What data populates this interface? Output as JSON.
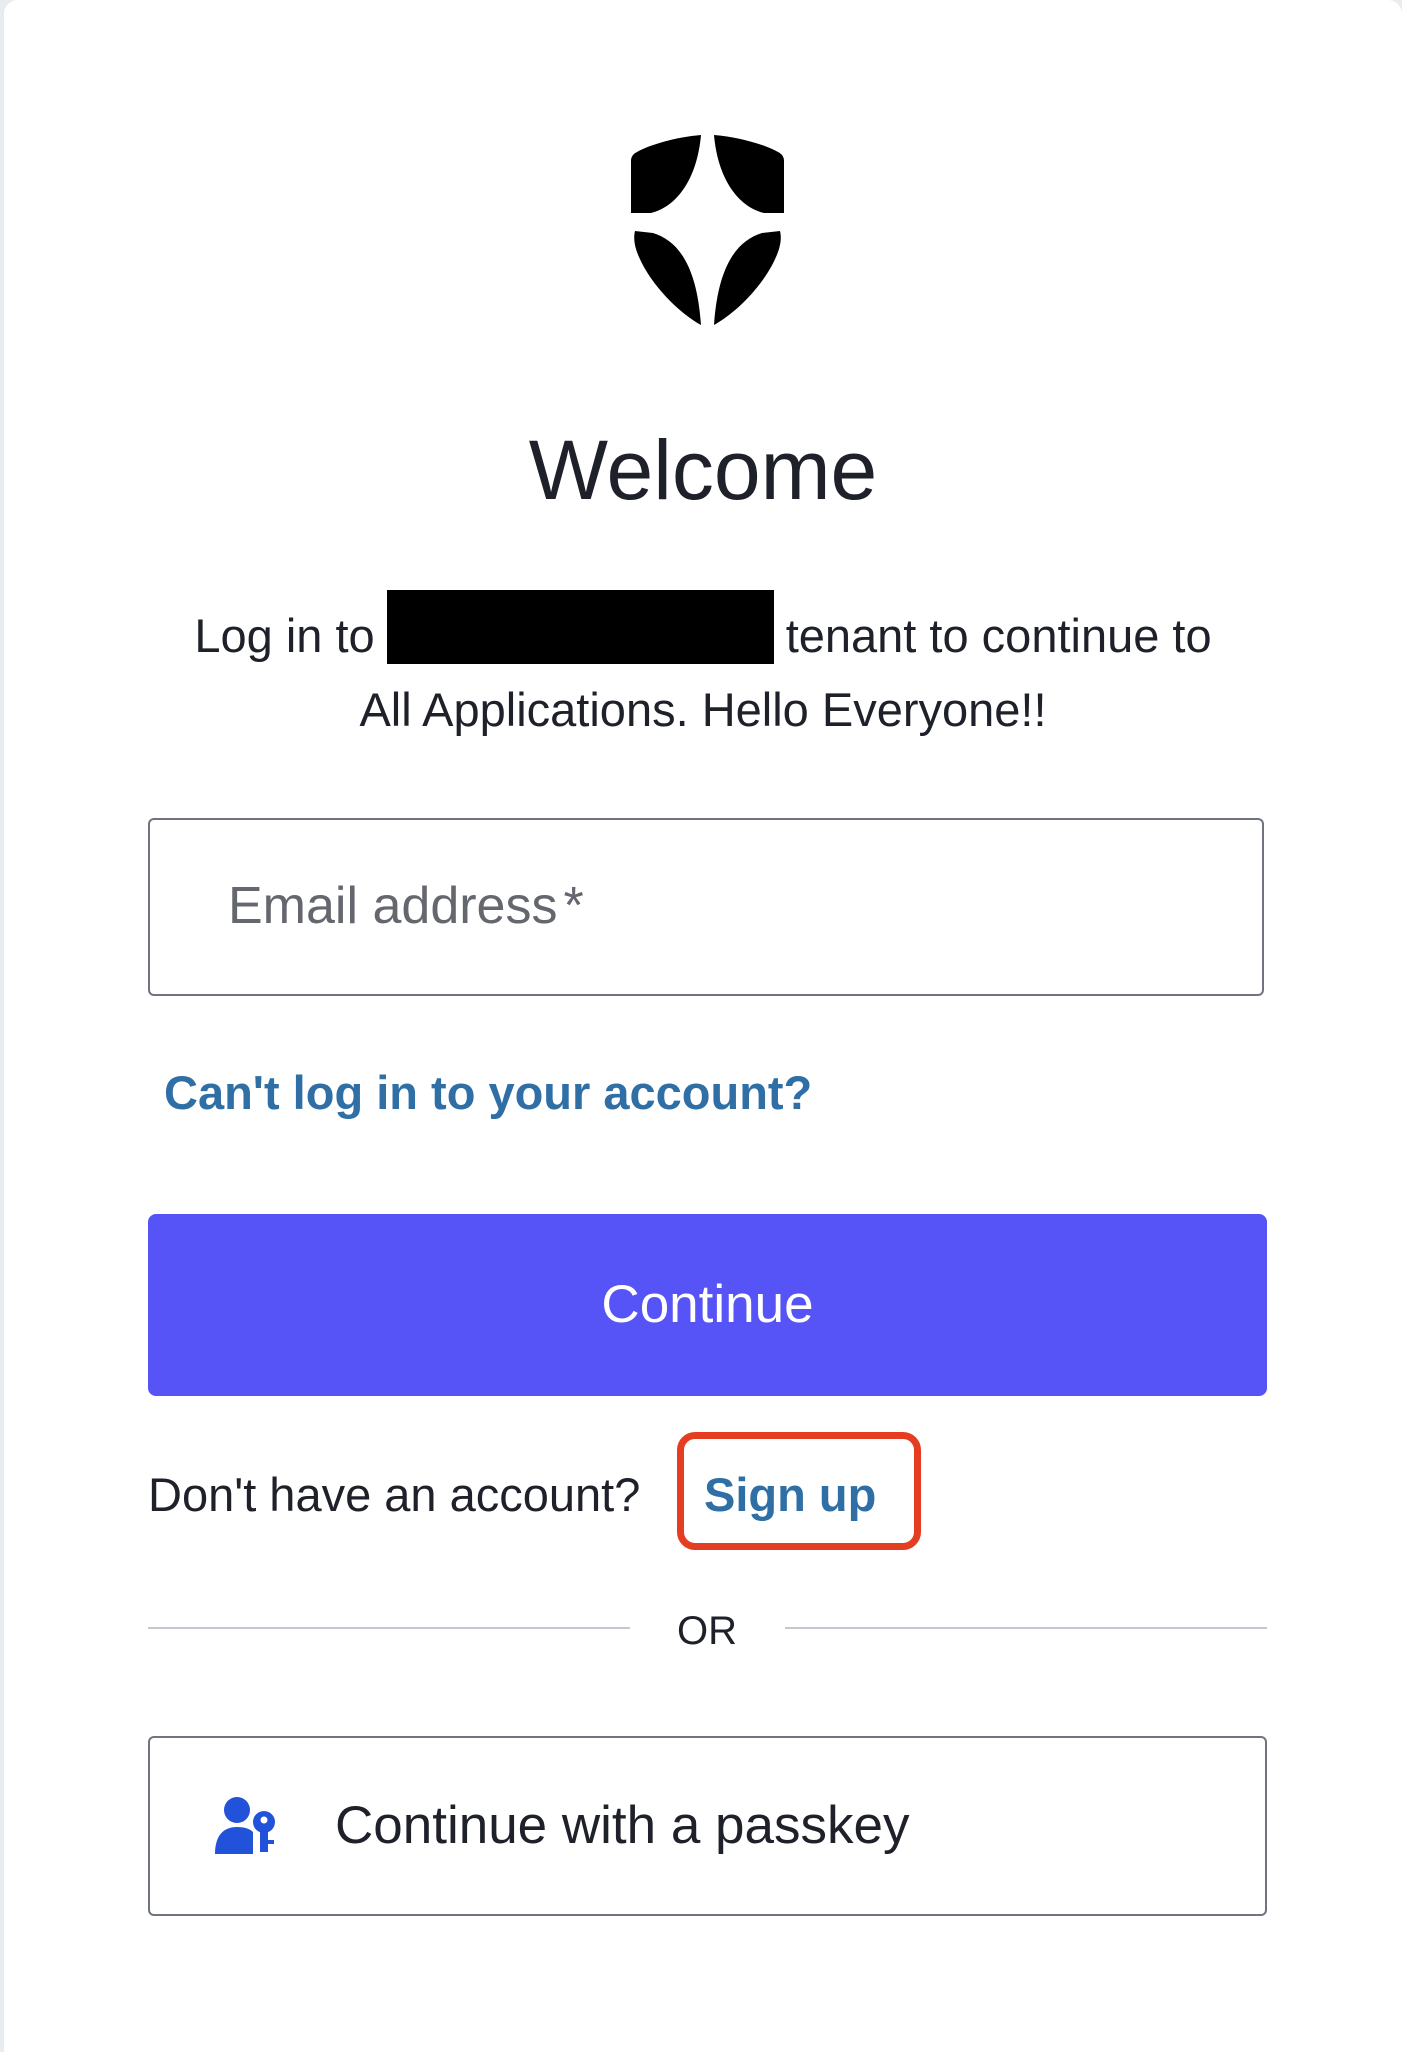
{
  "header": {
    "logo_icon": "shield-star-icon",
    "title": "Welcome",
    "subtitle_prefix": "Log in to",
    "subtitle_suffix": "tenant to continue to",
    "subtitle_line2": "All Applications. Hello Everyone!!"
  },
  "form": {
    "email_label": "Email address",
    "email_required_mark": "*",
    "email_value": "",
    "forgot_link": "Can't log in to your account?",
    "continue_label": "Continue"
  },
  "signup": {
    "prompt": "Don't have an account?",
    "link": "Sign up"
  },
  "divider": {
    "text": "OR"
  },
  "passkey": {
    "icon": "user-key-icon",
    "label": "Continue with a passkey"
  },
  "colors": {
    "primary_button": "#5653f7",
    "link": "#2f6fa5",
    "highlight": "#e43d22",
    "passkey_icon": "#2152d9"
  }
}
